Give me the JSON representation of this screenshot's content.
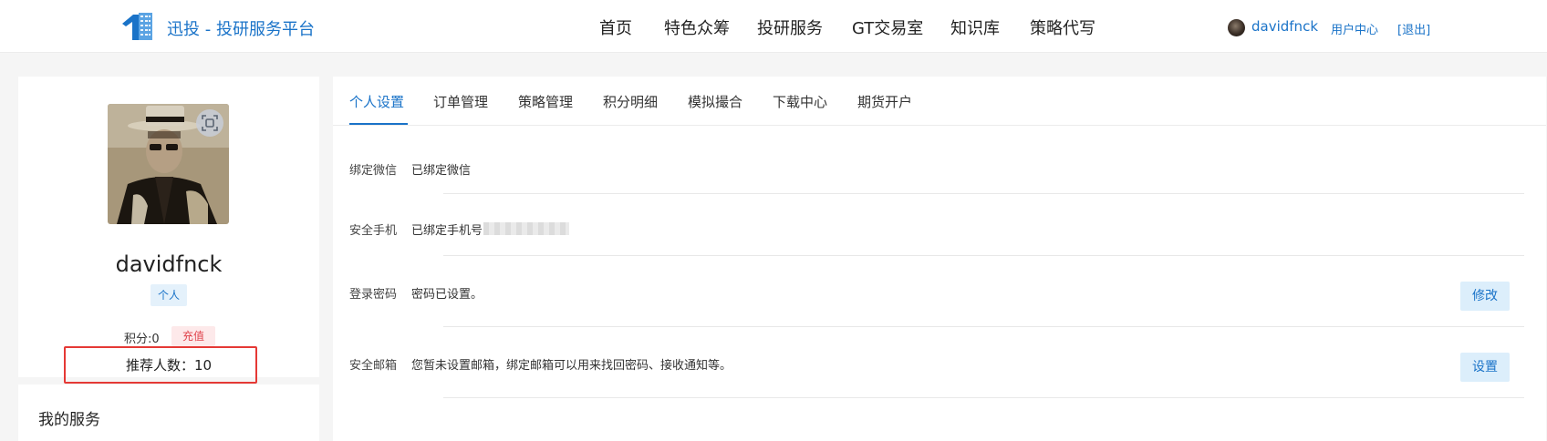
{
  "header": {
    "brand": "迅投 - 投研服务平台",
    "nav": [
      {
        "label": "首页"
      },
      {
        "label": "特色众筹"
      },
      {
        "label": "投研服务"
      },
      {
        "label": "GT交易室"
      },
      {
        "label": "知识库"
      },
      {
        "label": "策略代写"
      }
    ],
    "user": {
      "name": "davidfnck",
      "user_center": "用户中心",
      "logout": "[退出]"
    }
  },
  "profile": {
    "username": "davidfnck",
    "account_type": "个人",
    "points": "积分:0",
    "recharge_label": "充值",
    "referrals": "推荐人数：10"
  },
  "services": {
    "title": "我的服务"
  },
  "tabs": [
    {
      "label": "个人设置",
      "active": true
    },
    {
      "label": "订单管理",
      "active": false
    },
    {
      "label": "策略管理",
      "active": false
    },
    {
      "label": "积分明细",
      "active": false
    },
    {
      "label": "模拟撮合",
      "active": false
    },
    {
      "label": "下载中心",
      "active": false
    },
    {
      "label": "期货开户",
      "active": false
    }
  ],
  "settings": [
    {
      "label": "绑定微信",
      "value": "已绑定微信"
    },
    {
      "label": "安全手机",
      "value": "已绑定手机号:"
    },
    {
      "label": "登录密码",
      "value": "密码已设置。",
      "action": "修改"
    },
    {
      "label": "安全邮箱",
      "value": "您暂未设置邮箱，绑定邮箱可以用来找回密码、接收通知等。",
      "action": "设置"
    }
  ],
  "colors": {
    "primary": "#1a73c8",
    "highlight": "#e53935",
    "recharge": "#e0424b"
  }
}
